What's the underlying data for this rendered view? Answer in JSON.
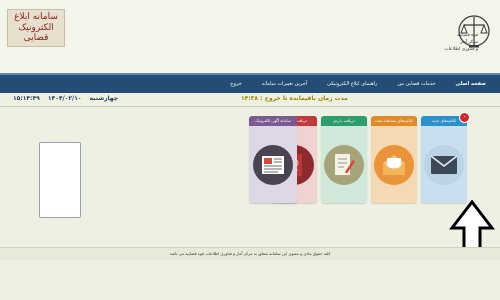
{
  "header": {
    "logo_text": "سامانه ابلاغ الکترونیک قضایی",
    "emblem_lines": [
      "قوه قضاییه",
      "مرکز آمار",
      "و فناوری اطلاعات"
    ]
  },
  "nav": {
    "items": [
      {
        "label": "صفحه اصلی"
      },
      {
        "label": "خدمات قضایی من"
      },
      {
        "label": "راهنمای ابلاغ الکترونیکی"
      },
      {
        "label": "آخرین تغییرات سامانه"
      },
      {
        "label": "خروج"
      }
    ]
  },
  "status": {
    "session_label": "مدت زمان باقیمانده تا خروج :",
    "session_value": "۱۴:۳۸",
    "day": "چهارشنبه",
    "date": "۱۴۰۴/۰۲/۱۰",
    "time": "۱۵:۱۴:۴۹"
  },
  "tiles": [
    {
      "header": "ابلاغیه‌های جدید",
      "color": "#2f8fc8",
      "icon": "envelope-icon",
      "badge": "۰"
    },
    {
      "header": "ابلاغیه‌های مشاهده شده",
      "color": "#e08a2a",
      "icon": "open-envelope-icon"
    },
    {
      "header": "دریافت با رمز",
      "color": "#2f9c6c",
      "icon": "document-pen-icon"
    },
    {
      "header": "دریافت با شماره",
      "color": "#c03b3b",
      "icon": "passport-icon"
    },
    {
      "header": "سامانه آگهی الکترونیک",
      "color": "#7b5a92",
      "icon": "newspaper-icon"
    }
  ],
  "footer": {
    "text": "کلیه حقوق مادی و معنوی این سامانه متعلق به مرکز آمار و فناوری اطلاعات قوه قضاییه می باشد"
  }
}
